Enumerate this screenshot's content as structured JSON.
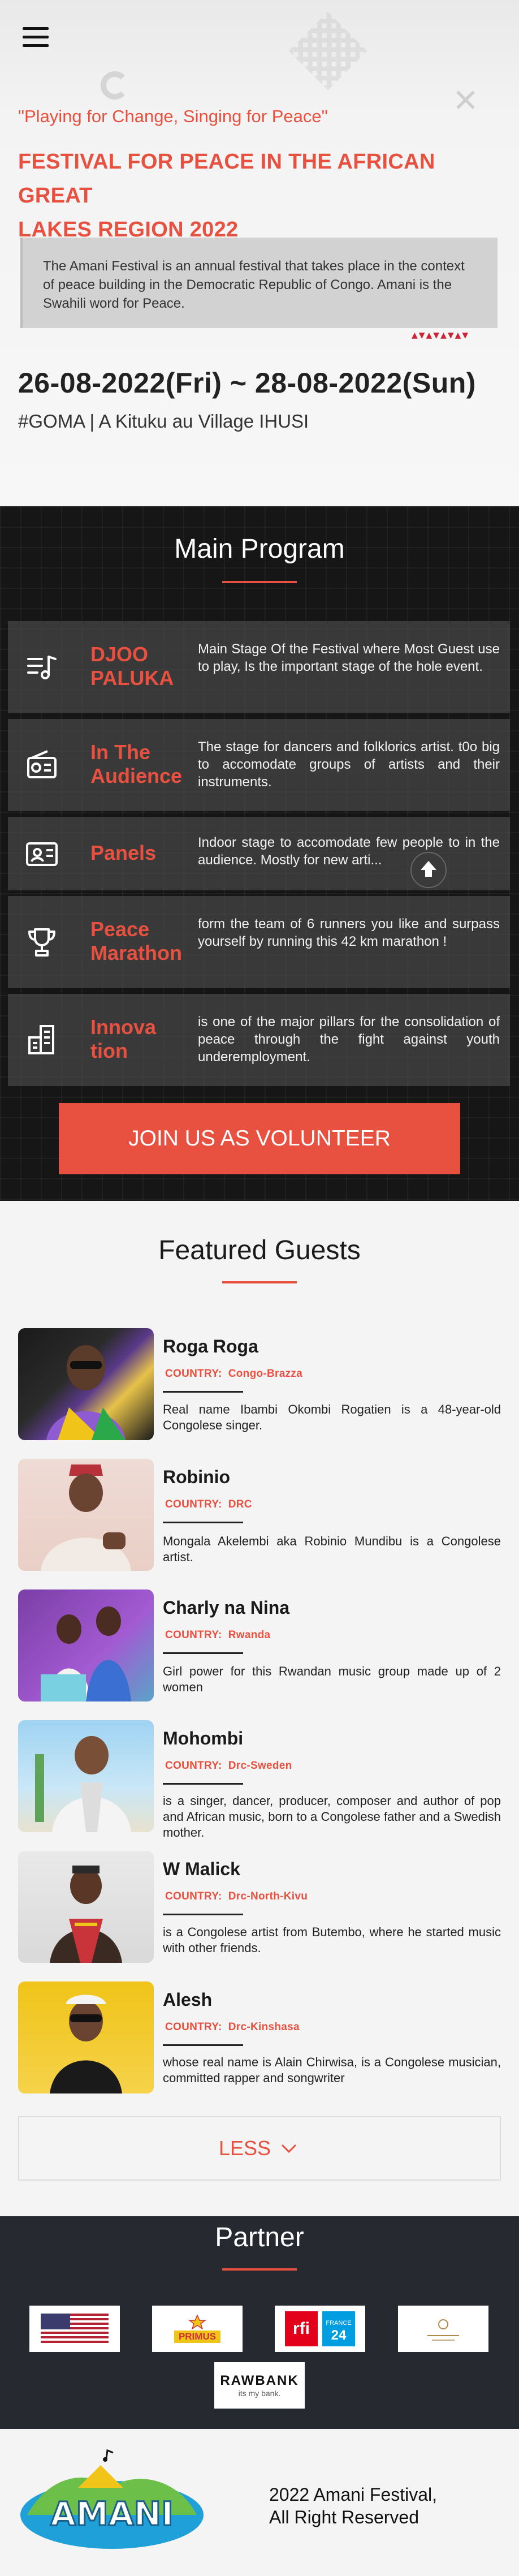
{
  "header": {
    "menu_icon": "hamburger-menu-icon"
  },
  "hero": {
    "slogan": "\"Playing for Change, Singing for Peace\"",
    "title_line1": "FESTIVAL FOR PEACE IN THE AFRICAN GREAT",
    "title_line2": "LAKES REGION 2022",
    "about": "The Amani Festival is an annual festival that takes place in the context of peace building in the Democratic Republic of Congo. Amani is the Swahili word for Peace.",
    "dates": "26-08-2022(Fri) ~ 28-08-2022(Sun)",
    "venue": "#GOMA | A Kituku au Village IHUSI"
  },
  "program": {
    "title": "Main Program",
    "items": [
      {
        "icon": "music-list-icon",
        "name": "DJOO PALUKA",
        "desc": "Main Stage Of the Festival where Most Guest use to play, Is the important stage of the hole event."
      },
      {
        "icon": "radio-icon",
        "name": "In The Audience",
        "desc": "The stage for dancers and folklorics artist. t0o big to accomodate groups of artists and their instruments."
      },
      {
        "icon": "id-card-icon",
        "name": "Panels",
        "desc": "Indoor stage to accomodate few people to in the audience. Mostly for new arti..."
      },
      {
        "icon": "trophy-icon",
        "name": "Peace Marathon",
        "desc": "form the team of 6 runners you like and surpass yourself by running this 42 km marathon !"
      },
      {
        "icon": "buildings-icon",
        "name": "Innova tion",
        "desc": "is one of the major pillars for the consolidation of peace through the fight against youth underemployment."
      }
    ],
    "volunteer_label": "JOIN US AS VOLUNTEER",
    "scroll_up_icon": "scroll-up-icon"
  },
  "guests": {
    "title": "Featured Guests",
    "country_label": "COUNTRY:",
    "items": [
      {
        "name": "Roga Roga",
        "country": "Congo-Brazza",
        "bio": "Real name Ibambi Okombi Rogatien is a 48-year-old Congolese singer."
      },
      {
        "name": "Robinio",
        "country": "DRC",
        "bio": "Mongala Akelembi aka Robinio Mundibu is a Congolese artist."
      },
      {
        "name": "Charly na Nina",
        "country": "Rwanda",
        "bio": "Girl power for this Rwandan music group made up of 2 women"
      },
      {
        "name": "Mohombi",
        "country": "Drc-Sweden",
        "bio": "is a singer, dancer, producer, composer and author of pop and African music, born to a Congolese father and a Swedish mother."
      },
      {
        "name": "W Malick",
        "country": "Drc-North-Kivu",
        "bio": "is a Congolese artist from Butembo, where he started music with other friends."
      },
      {
        "name": "Alesh",
        "country": "Drc-Kinshasa",
        "bio": "whose real name is Alain Chirwisa, is a Congolese musician, committed rapper and songwriter"
      }
    ],
    "less_label": "LESS"
  },
  "partner": {
    "title": "Partner",
    "logos": [
      {
        "name": "us-embassy-logo",
        "text": ""
      },
      {
        "name": "primus-logo",
        "text": "PRIMUS"
      },
      {
        "name": "rfi-france24-logo",
        "text": "rfi FRANCE 24"
      },
      {
        "name": "hotel-logo",
        "text": ""
      },
      {
        "name": "rawbank-logo",
        "text": "RAWBANK",
        "sub": "its my bank."
      }
    ]
  },
  "footer": {
    "logo_text": "AMANI",
    "copyright_line1": "2022 Amani Festival,",
    "copyright_line2": "All Right Reserved"
  },
  "colors": {
    "accent": "#e8503f",
    "dark": "#161616",
    "partner_bg": "#262a30"
  }
}
